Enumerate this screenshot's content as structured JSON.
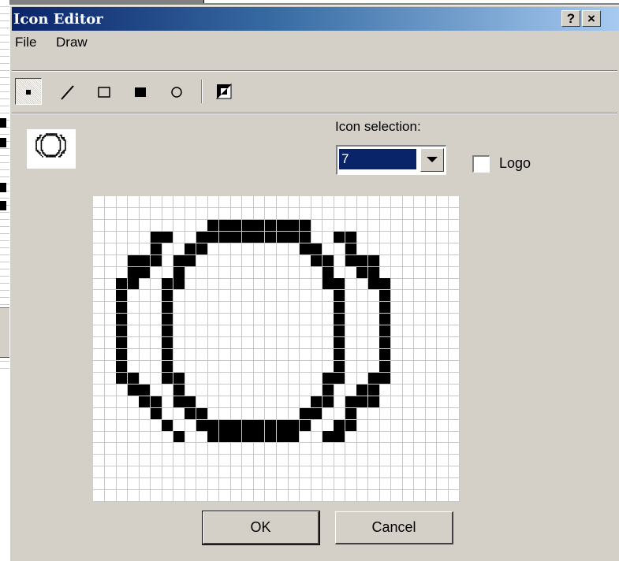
{
  "window": {
    "title": "Icon Editor",
    "help_label": "?",
    "close_label": "×"
  },
  "menu": {
    "items": [
      "File",
      "Draw"
    ]
  },
  "toolbar": {
    "tools": [
      "point-tool",
      "line-tool",
      "rectangle-tool",
      "filled-rectangle-tool",
      "ellipse-tool",
      "invert-tool"
    ],
    "selected_tool": "point-tool"
  },
  "icon_selection": {
    "label": "Icon selection:",
    "value": "7"
  },
  "logo": {
    "label": "Logo",
    "checked": false
  },
  "pixel_grid": {
    "cols": 32,
    "rows": 26,
    "pixels": [
      "................................",
      "................................",
      "..........#########.............",
      ".....##..##########..##.........",
      ".....#..##........##..#.........",
      "...###.##..........##.###.......",
      "...##..#............#..##.......",
      "..##..##............##..##......",
      "..#...#..............#...#......",
      "..#...#..............#...#......",
      "..#...#..............#...#......",
      "..#...#..............#...#......",
      "..#...#..............#...#......",
      "..#...#..............#...#......",
      "..#...#..............#...#......",
      "..##..##............##..##......",
      "...##..#............#..##.......",
      "....##.##..........##.###.......",
      ".....#..##........##..#.........",
      "......#..##########..##.........",
      ".......#..########..##..........",
      "................................",
      "................................",
      "................................",
      "................................",
      "................................"
    ]
  },
  "buttons": {
    "ok": "OK",
    "cancel": "Cancel"
  }
}
